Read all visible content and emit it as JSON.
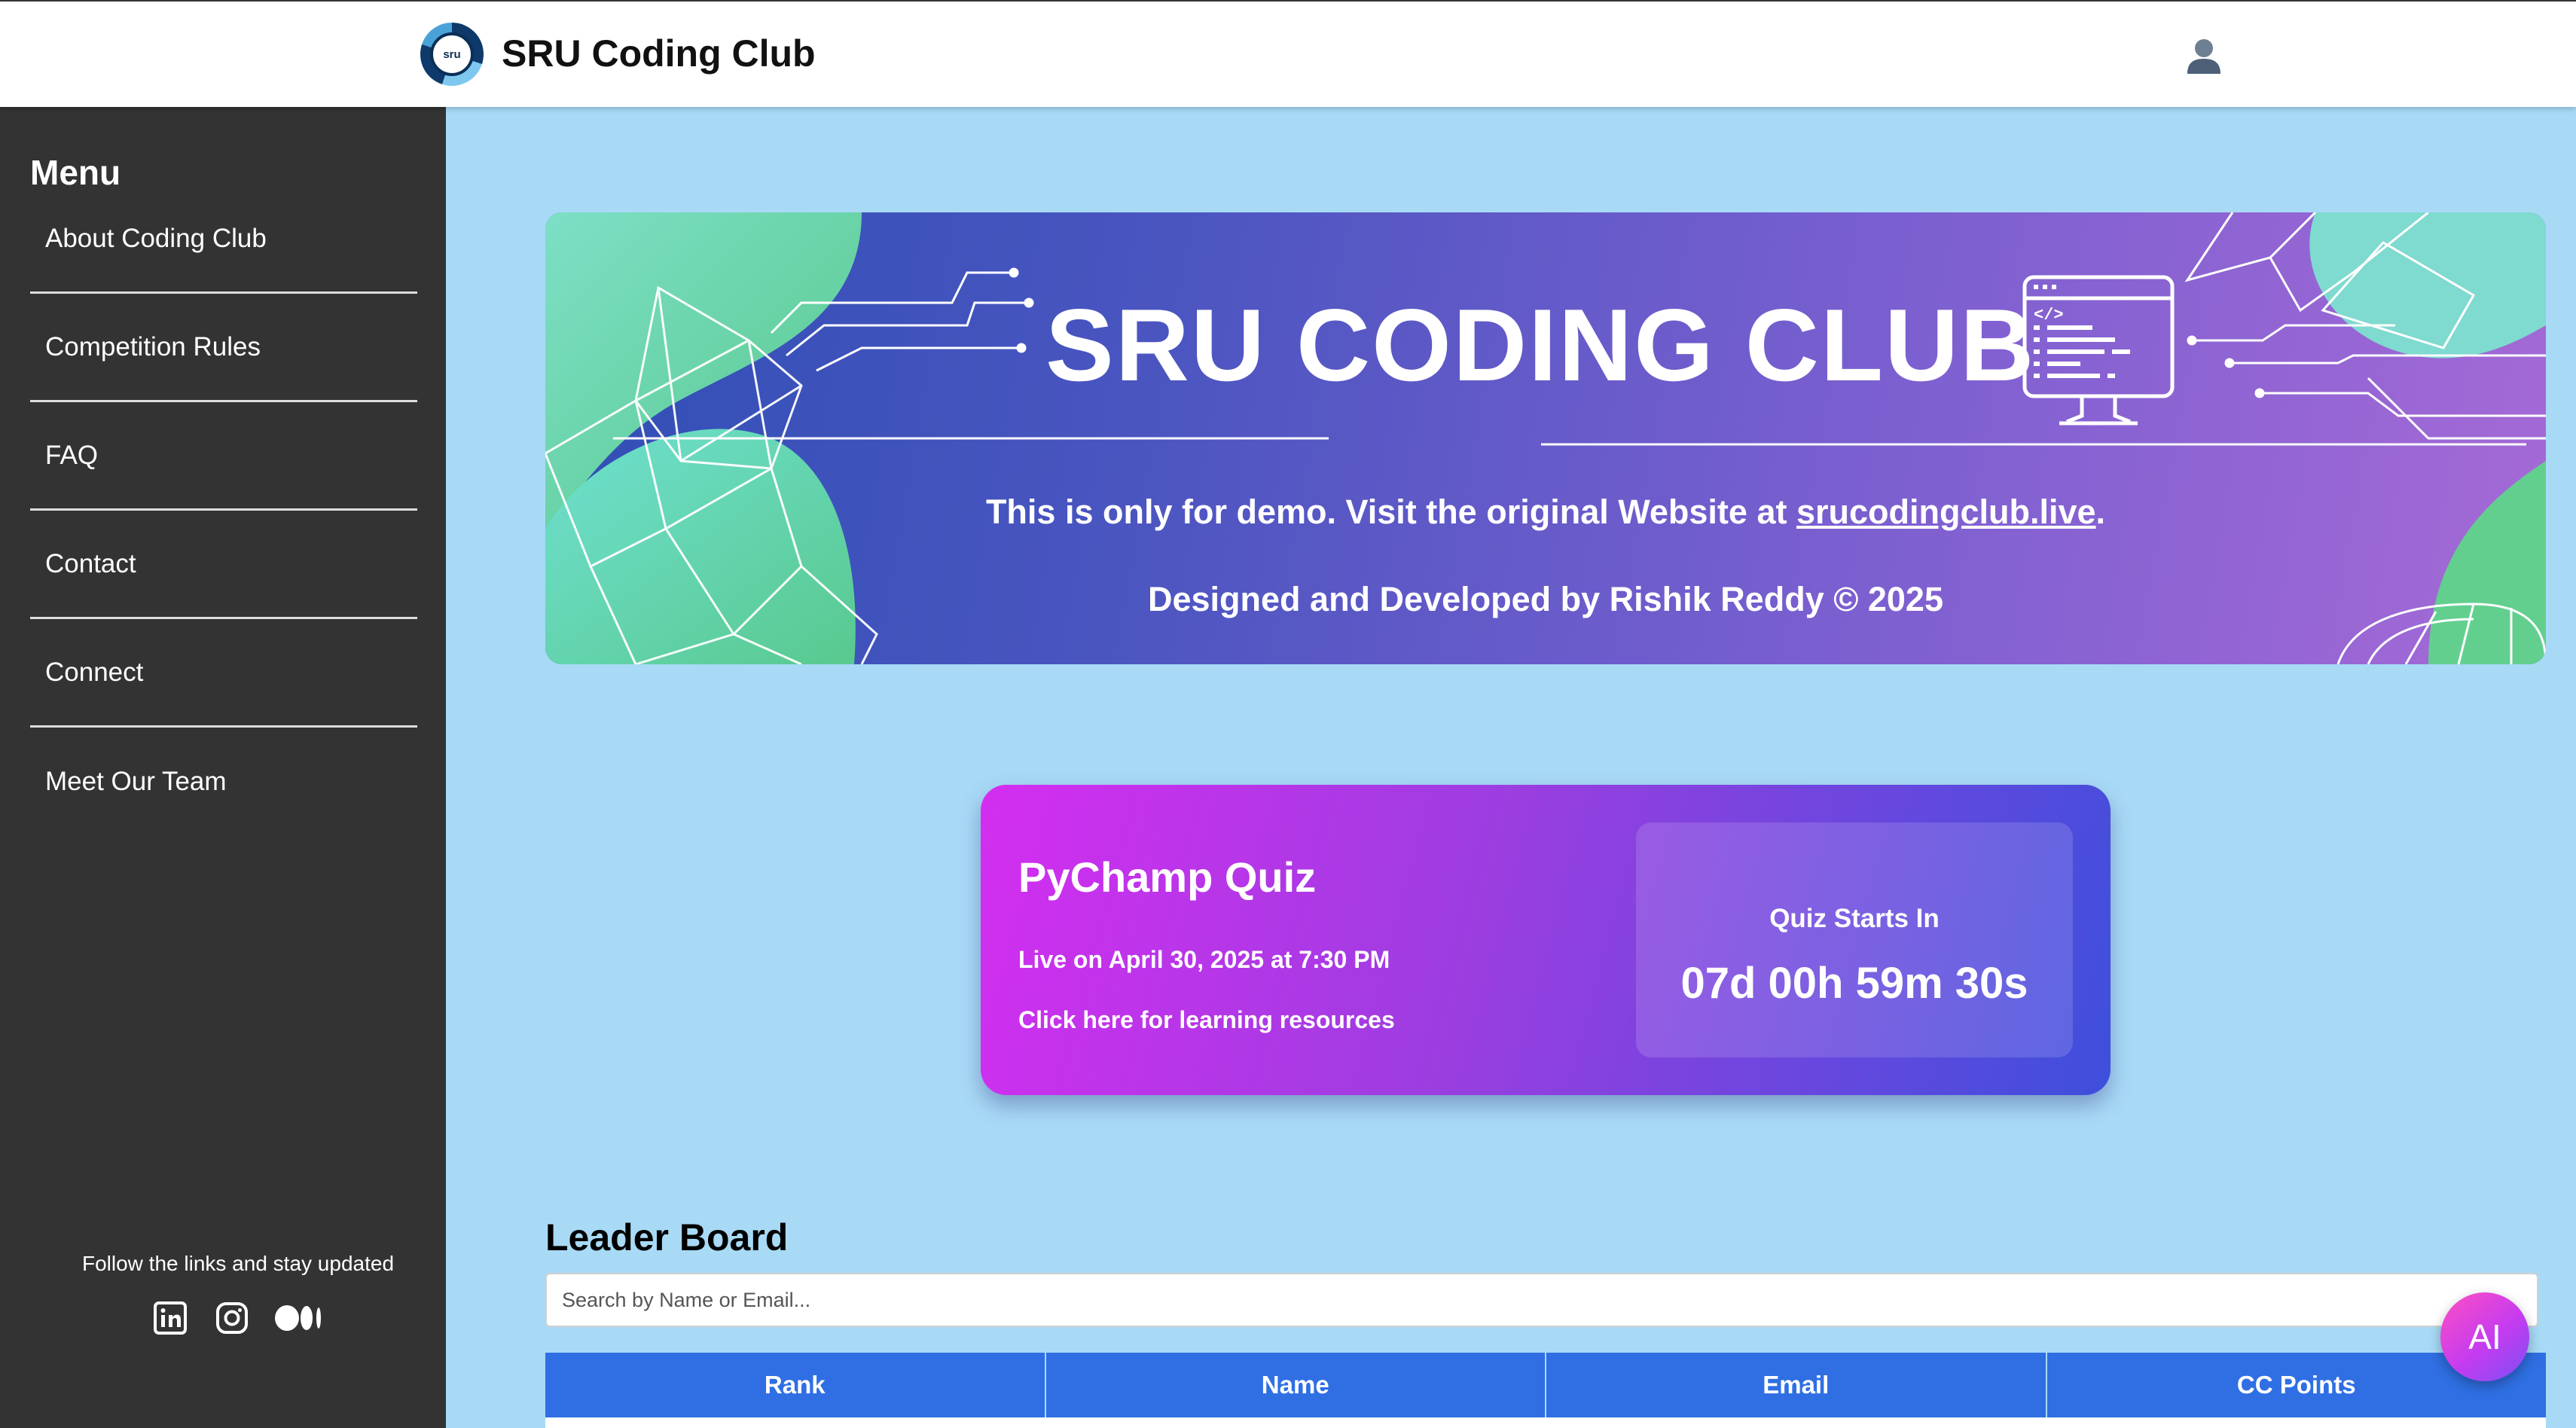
{
  "header": {
    "logo_text": "sru",
    "title": "SRU Coding Club",
    "user_icon": "user-icon"
  },
  "sidebar": {
    "title": "Menu",
    "items": [
      {
        "label": "About Coding Club"
      },
      {
        "label": "Competition Rules"
      },
      {
        "label": "FAQ"
      },
      {
        "label": "Contact"
      },
      {
        "label": "Connect"
      },
      {
        "label": "Meet Our Team"
      }
    ],
    "follow_text": "Follow the links and stay updated",
    "socials": [
      "linkedin-icon",
      "instagram-icon",
      "medium-icon"
    ]
  },
  "banner": {
    "title": "SRU CODING CLUB",
    "line1_prefix": "This is only for demo. Visit the original Website at ",
    "line1_link": "srucodingclub.live",
    "line1_suffix": ".",
    "line2": "Designed and Developed by Rishik Reddy © 2025"
  },
  "quiz": {
    "title": "PyChamp Quiz",
    "date": "Live on April 30, 2025 at 7:30 PM",
    "resources_link": "Click here for learning resources",
    "countdown_label": "Quiz Starts In",
    "countdown_value": "07d 00h 59m 30s"
  },
  "leaderboard": {
    "title": "Leader Board",
    "search_placeholder": "Search by Name or Email...",
    "columns": [
      "Rank",
      "Name",
      "Email",
      "CC Points"
    ]
  },
  "ai_button": {
    "label": "AI"
  }
}
